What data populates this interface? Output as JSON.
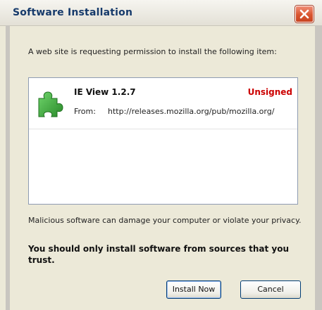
{
  "window": {
    "title": "Software Installation"
  },
  "prompt": "A web site is requesting permission to install the following item:",
  "item": {
    "name": "IE View 1.2.7",
    "status": "Unsigned",
    "from_label": "From:",
    "from_url": "http://releases.mozilla.org/pub/mozilla.org/"
  },
  "warning": "Malicious software can damage your computer or violate your privacy.",
  "advice": "You should only install software from sources that you trust.",
  "buttons": {
    "install_label": "Install Now",
    "cancel_label": "Cancel"
  },
  "icons": {
    "close": "close-icon",
    "extension": "puzzle-piece-icon"
  },
  "colors": {
    "title_text": "#163a6b",
    "close_button": "#d9552f",
    "unsigned_text": "#cc0000",
    "puzzle_green": "#3aa33a"
  }
}
